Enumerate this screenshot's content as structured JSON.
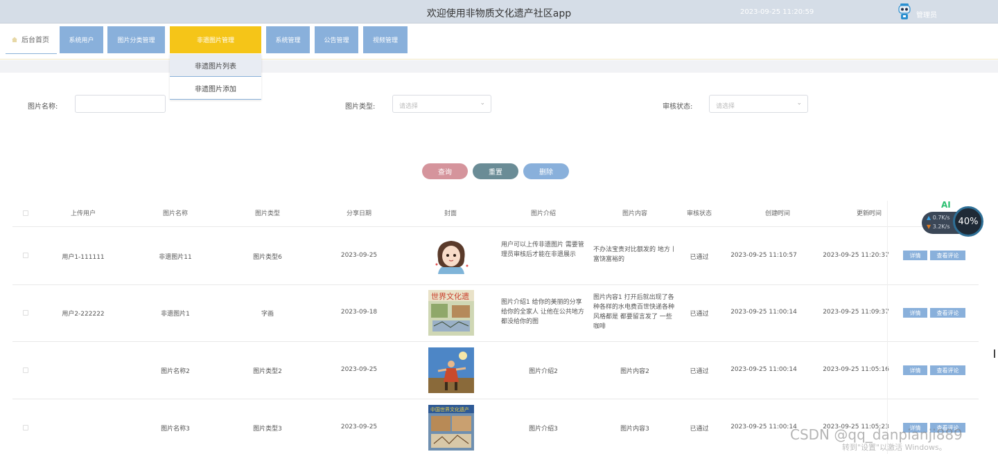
{
  "header": {
    "title": "欢迎使用非物质文化遗产社区app",
    "datetime": "2023-09-25 11:20:59",
    "role": "管理员"
  },
  "nav": {
    "home": "后台首页",
    "items": [
      "系统用户",
      "图片分类管理",
      "非遗图片管理",
      "系统管理",
      "公告管理",
      "视频管理"
    ],
    "active_index": 2,
    "dropdown": [
      "非遗图片列表",
      "非遗图片添加"
    ]
  },
  "filters": {
    "name_label": "图片名称:",
    "type_label": "图片类型:",
    "type_placeholder": "请选择",
    "status_label": "审核状态:",
    "status_placeholder": "请选择"
  },
  "buttons": {
    "query": "查询",
    "reset": "重置",
    "delete": "删除"
  },
  "table": {
    "headers": [
      "上传用户",
      "图片名称",
      "图片类型",
      "分享日期",
      "封面",
      "图片介绍",
      "图片内容",
      "审核状态",
      "创建时间",
      "更新时间"
    ],
    "rows": [
      {
        "user": "用户1-111111",
        "name": "非遗图片11",
        "type": "图片类型6",
        "date": "2023-09-25",
        "intro": "用户可以上传非遗图片 需要管理员审核后才能在非遗展示",
        "content": "不办法宝贵对比额发的 地方丨富饶富裕的",
        "status": "已通过",
        "created": "2023-09-25 11:10:57",
        "updated": "2023-09-25 11:20:37",
        "cover": "avatar"
      },
      {
        "user": "用户2-222222",
        "name": "非遗图片1",
        "type": "字画",
        "date": "2023-09-18",
        "intro": "图片介绍1 给你的美丽的分享给你的全家人 让他在公共地方 都没给你的图",
        "content": "图片内容1 打开后就出现了各种各样的水电费百世快递各种风格都是 都要留言发了 一些咖啡",
        "status": "已通过",
        "created": "2023-09-25 11:00:14",
        "updated": "2023-09-25 11:09:37",
        "cover": "world-heritage"
      },
      {
        "user": "",
        "name": "图片名称2",
        "type": "图片类型2",
        "date": "2023-09-25",
        "intro": "图片介绍2",
        "content": "图片内容2",
        "status": "已通过",
        "created": "2023-09-25 11:00:14",
        "updated": "2023-09-25 11:05:16",
        "cover": "dance"
      },
      {
        "user": "",
        "name": "图片名称3",
        "type": "图片类型3",
        "date": "2023-09-25",
        "intro": "图片介绍3",
        "content": "图片内容3",
        "status": "已通过",
        "created": "2023-09-25 11:00:14",
        "updated": "2023-09-25 11:05:23",
        "cover": "heritage-poster"
      }
    ],
    "detail_label": "详情",
    "comment_label": "查看评论"
  },
  "widget": {
    "ai": "AI",
    "up": "0.7K/s",
    "down": "3.2K/s",
    "percent": "40%"
  },
  "watermark": {
    "csdn": "CSDN @qq_danpianji889",
    "windows": "转到\"设置\"以激活 Windows。"
  },
  "colors": {
    "nav_blue": "#89b0db",
    "nav_active": "#f5c518",
    "query_pink": "#d5949c",
    "reset_teal": "#6a8c96",
    "delete_blue": "#89b0db"
  },
  "icons": {
    "home": "home-icon",
    "robot": "robot-icon",
    "sort": "sort-icon",
    "chevron": "chevron-down-icon"
  }
}
